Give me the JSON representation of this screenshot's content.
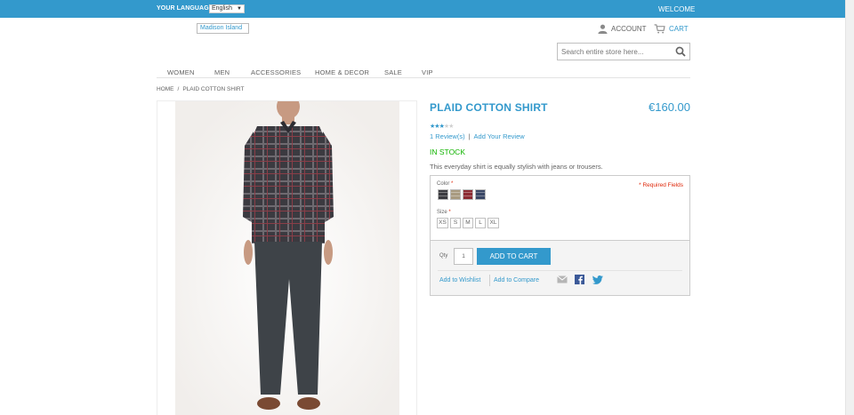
{
  "header": {
    "language_label": "YOUR LANGUAGE",
    "language_value": "English",
    "welcome": "WELCOME",
    "logo_alt": "Madison Island",
    "account": "ACCOUNT",
    "cart": "CART",
    "search_placeholder": "Search entire store here..."
  },
  "nav": {
    "items": [
      "WOMEN",
      "MEN",
      "ACCESSORIES",
      "HOME & DECOR",
      "SALE",
      "VIP"
    ]
  },
  "breadcrumb": {
    "home": "HOME",
    "separator": "/",
    "current": "PLAID COTTON SHIRT"
  },
  "product": {
    "name": "PLAID COTTON SHIRT",
    "price": "€160.00",
    "rating_stars": 2.5,
    "rating_max": 5,
    "reviews_link": "1 Review(s)",
    "add_review": "Add Your Review",
    "stock": "IN STOCK",
    "description": "This everyday shirt is equally stylish with jeans or trousers."
  },
  "options": {
    "color_label": "Color",
    "required_marker": "*",
    "required_fields": "* Required Fields",
    "swatch_colors": [
      "#3a3a3f",
      "#a89a80",
      "#8c2b33",
      "#3a4766"
    ],
    "size_label": "Size",
    "sizes": [
      "XS",
      "S",
      "M",
      "L",
      "XL"
    ]
  },
  "cart_box": {
    "qty_label": "Qty",
    "qty_value": "1",
    "add_to_cart": "ADD TO CART",
    "wishlist": "Add to Wishlist",
    "compare": "Add to Compare"
  },
  "colors": {
    "accent": "#3399cc",
    "stock_green": "#11b400",
    "required_red": "#df280a"
  }
}
